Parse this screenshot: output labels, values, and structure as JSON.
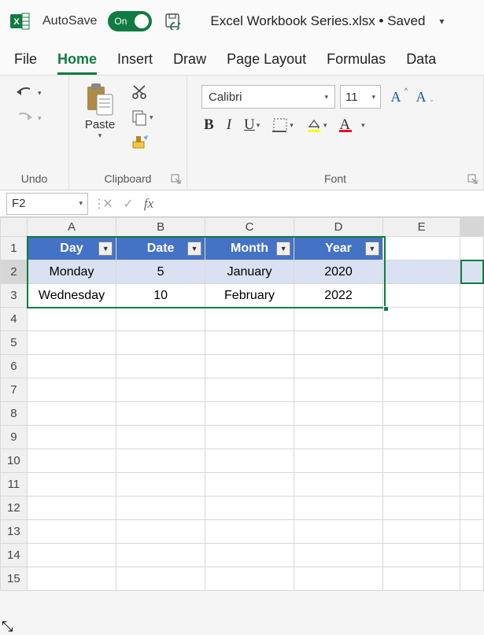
{
  "titlebar": {
    "autosave": "AutoSave",
    "toggle_on": "On",
    "filename": "Excel Workbook Series.xlsx • Saved"
  },
  "tabs": {
    "file": "File",
    "home": "Home",
    "insert": "Insert",
    "draw": "Draw",
    "page_layout": "Page Layout",
    "formulas": "Formulas",
    "data": "Data"
  },
  "ribbon": {
    "undo_label": "Undo",
    "paste_label": "Paste",
    "clipboard_label": "Clipboard",
    "font_label": "Font",
    "font_name": "Calibri",
    "font_size": "11"
  },
  "formulabar": {
    "namebox": "F2",
    "formula": ""
  },
  "columns": [
    "A",
    "B",
    "C",
    "D",
    "E"
  ],
  "rows_visible": 15,
  "table": {
    "headers": [
      "Day",
      "Date",
      "Month",
      "Year"
    ],
    "rows": [
      {
        "day": "Monday",
        "date": "5",
        "month": "January",
        "year": "2020"
      },
      {
        "day": "Wednesday",
        "date": "10",
        "month": "February",
        "year": "2022"
      }
    ]
  }
}
